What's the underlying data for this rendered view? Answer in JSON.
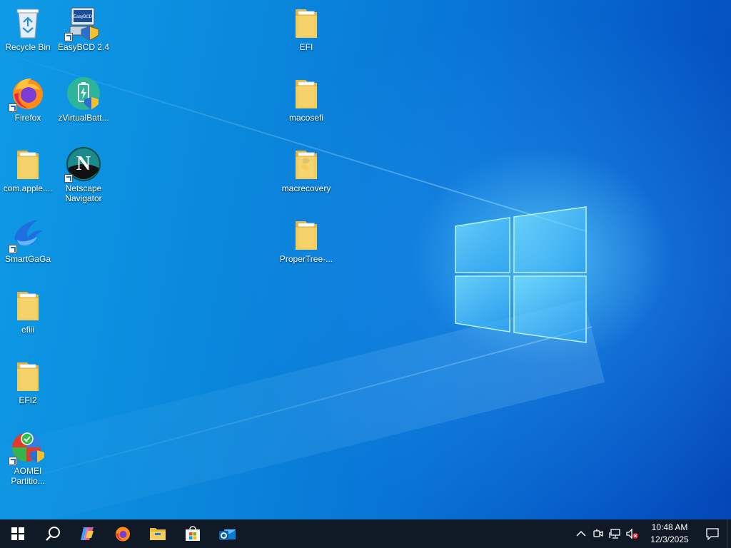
{
  "desktop": {
    "icons": [
      {
        "label": "Recycle Bin",
        "icon": "recycle-bin-icon"
      },
      {
        "label": "EasyBCD 2.4",
        "icon": "easybcd-icon"
      },
      {
        "label": "EFI",
        "icon": "folder-icon"
      },
      {
        "label": "Firefox",
        "icon": "firefox-icon"
      },
      {
        "label": "zVirtualBatt...",
        "icon": "battery-app-icon"
      },
      {
        "label": "macosefi",
        "icon": "folder-icon"
      },
      {
        "label": "com.apple....",
        "icon": "folder-icon"
      },
      {
        "label": "Netscape\nNavigator",
        "icon": "netscape-icon"
      },
      {
        "label": "macrecovery",
        "icon": "folder-icon"
      },
      {
        "label": "SmartGaGa",
        "icon": "smartgaga-icon"
      },
      {
        "label": "ProperTree-...",
        "icon": "folder-icon"
      },
      {
        "label": "efiii",
        "icon": "folder-icon"
      },
      {
        "label": "EFI2",
        "icon": "folder-icon"
      },
      {
        "label": "AOMEI\nPartitio...",
        "icon": "aomei-icon"
      }
    ]
  },
  "taskbar": {
    "pinned": [
      "start-icon",
      "search-icon",
      "copilot-icon",
      "firefox-icon",
      "file-explorer-icon",
      "microsoft-store-icon",
      "outlook-icon"
    ],
    "tray": {
      "icons": [
        "chevron-up-icon",
        "meet-now-icon",
        "network-icon",
        "volume-muted-icon"
      ],
      "time": "10:48 AM",
      "date": "12/3/2025"
    },
    "notification_icon": "action-center-icon"
  },
  "colors": {
    "taskbar_bg": "#0f1a26",
    "desktop_blue": "#0a86db",
    "folder_yellow": "#f4cf5d"
  }
}
